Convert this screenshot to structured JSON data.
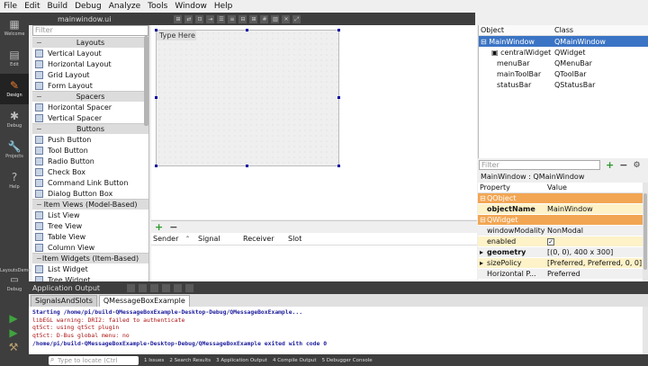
{
  "menu": [
    "File",
    "Edit",
    "Build",
    "Debug",
    "Analyze",
    "Tools",
    "Window",
    "Help"
  ],
  "modes": [
    {
      "label": "Welcome",
      "icon": "▦"
    },
    {
      "label": "Edit",
      "icon": "▤"
    },
    {
      "label": "Design",
      "icon": "✎"
    },
    {
      "label": "Debug",
      "icon": "✱"
    },
    {
      "label": "Projects",
      "icon": "🔧"
    },
    {
      "label": "Help",
      "icon": "?"
    }
  ],
  "kit": {
    "project": "LayoutsDemo",
    "config": "Debug"
  },
  "document": {
    "title": "mainwindow.ui"
  },
  "widgetbox": {
    "filter_placeholder": "Filter",
    "sections": [
      {
        "title": "Layouts",
        "items": [
          "Vertical Layout",
          "Horizontal Layout",
          "Grid Layout",
          "Form Layout"
        ]
      },
      {
        "title": "Spacers",
        "items": [
          "Horizontal Spacer",
          "Vertical Spacer"
        ]
      },
      {
        "title": "Buttons",
        "items": [
          "Push Button",
          "Tool Button",
          "Radio Button",
          "Check Box",
          "Command Link Button",
          "Dialog Button Box"
        ]
      },
      {
        "title": "Item Views (Model-Based)",
        "items": [
          "List View",
          "Tree View",
          "Table View",
          "Column View"
        ]
      },
      {
        "title": "Item Widgets (Item-Based)",
        "items": [
          "List Widget",
          "Tree Widget"
        ]
      }
    ]
  },
  "form": {
    "menu_placeholder": "Type Here"
  },
  "signals": {
    "columns": [
      "Sender",
      "Signal",
      "Receiver",
      "Slot"
    ]
  },
  "object_inspector": {
    "columns": [
      "Object",
      "Class"
    ],
    "rows": [
      {
        "object": "MainWindow",
        "class": "QMainWindow",
        "selected": true
      },
      {
        "object": "centralWidget",
        "class": "QWidget",
        "selected": false
      },
      {
        "object": "menuBar",
        "class": "QMenuBar",
        "selected": false
      },
      {
        "object": "mainToolBar",
        "class": "QToolBar",
        "selected": false
      },
      {
        "object": "statusBar",
        "class": "QStatusBar",
        "selected": false
      }
    ]
  },
  "property_editor": {
    "filter_placeholder": "Filter",
    "object_label": "MainWindow : QMainWindow",
    "columns": [
      "Property",
      "Value"
    ],
    "rows": [
      {
        "kind": "group",
        "name": "QObject",
        "value": ""
      },
      {
        "kind": "yel",
        "name": "objectName",
        "value": "MainWindow",
        "bold": true
      },
      {
        "kind": "group",
        "name": "QWidget",
        "value": ""
      },
      {
        "kind": "grey",
        "name": "windowModality",
        "value": "NonModal"
      },
      {
        "kind": "yel",
        "name": "enabled",
        "value": "",
        "check": true
      },
      {
        "kind": "grey",
        "name": "geometry",
        "value": "[(0, 0), 400 x 300]",
        "bold": true,
        "expand": true
      },
      {
        "kind": "yel",
        "name": "sizePolicy",
        "value": "[Preferred, Preferred, 0, 0]",
        "expand": true
      },
      {
        "kind": "grey",
        "name": "Horizontal P...",
        "value": "Preferred"
      }
    ]
  },
  "output": {
    "pane_title": "Application Output",
    "tabs": [
      "SignalsAndSlots",
      "QMessageBoxExample"
    ],
    "lines": [
      {
        "text": "Starting /home/pi/build-QMessageBoxExample-Desktop-Debug/QMessageBoxExample...",
        "style": "blue"
      },
      {
        "text": "libEGL warning: DRI2: failed to authenticate",
        "style": "red"
      },
      {
        "text": "qt5ct: using qt5ct plugin",
        "style": "red"
      },
      {
        "text": "qt5ct: D-Bus global menu: no",
        "style": "red"
      },
      {
        "text": "/home/pi/build-QMessageBoxExample-Desktop-Debug/QMessageBoxExample exited with code 0",
        "style": "blue"
      }
    ]
  },
  "statusbar": {
    "locate_placeholder": "Type to locate (Ctrl",
    "panes": [
      "1 Issues",
      "2 Search Results",
      "3 Application Output",
      "4 Compile Output",
      "5 Debugger Console"
    ]
  }
}
